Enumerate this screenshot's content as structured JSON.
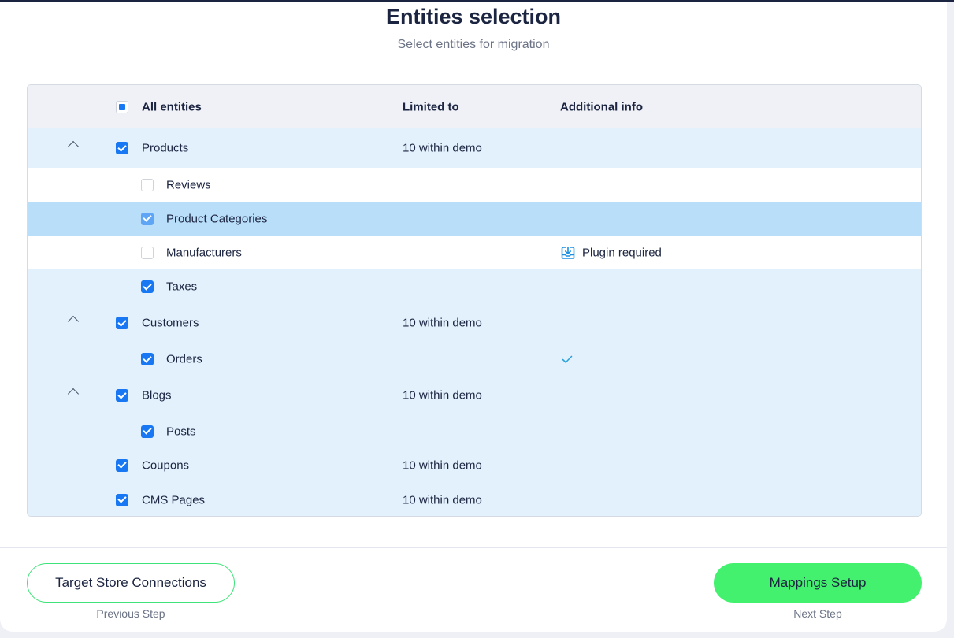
{
  "header": {
    "title": "Entities selection",
    "subtitle": "Select entities for migration"
  },
  "table": {
    "columns": {
      "entities": "All entities",
      "limited": "Limited to",
      "info": "Additional info"
    },
    "rows": [
      {
        "label": "Products",
        "level": 0,
        "checked": true,
        "collapsible": true,
        "limited": "10 within demo",
        "info": ""
      },
      {
        "label": "Reviews",
        "level": 1,
        "checked": false,
        "collapsible": false,
        "limited": "",
        "info": ""
      },
      {
        "label": "Product Categories",
        "level": 1,
        "checked": true,
        "collapsible": false,
        "limited": "",
        "info": "",
        "selected": true
      },
      {
        "label": "Manufacturers",
        "level": 1,
        "checked": false,
        "collapsible": false,
        "limited": "",
        "info": "Plugin required",
        "info_icon": "download-plugin-icon"
      },
      {
        "label": "Taxes",
        "level": 1,
        "checked": true,
        "collapsible": false,
        "limited": "",
        "info": ""
      },
      {
        "label": "Customers",
        "level": 0,
        "checked": true,
        "collapsible": true,
        "limited": "10 within demo",
        "info": ""
      },
      {
        "label": "Orders",
        "level": 1,
        "checked": true,
        "collapsible": false,
        "limited": "",
        "info": "",
        "info_icon": "check-icon"
      },
      {
        "label": "Blogs",
        "level": 0,
        "checked": true,
        "collapsible": true,
        "limited": "10 within demo",
        "info": ""
      },
      {
        "label": "Posts",
        "level": 1,
        "checked": true,
        "collapsible": false,
        "limited": "",
        "info": ""
      },
      {
        "label": "Coupons",
        "level": 0,
        "checked": true,
        "collapsible": false,
        "limited": "10 within demo",
        "info": ""
      },
      {
        "label": "CMS Pages",
        "level": 0,
        "checked": true,
        "collapsible": false,
        "limited": "10 within demo",
        "info": ""
      }
    ]
  },
  "footer": {
    "prev_button": "Target Store Connections",
    "prev_caption": "Previous Step",
    "next_button": "Mappings Setup",
    "next_caption": "Next Step"
  },
  "colors": {
    "accent": "#1877f2",
    "next_button": "#43f16e",
    "row_highlight": "#e3f1fd",
    "row_selected": "#b9def9"
  }
}
